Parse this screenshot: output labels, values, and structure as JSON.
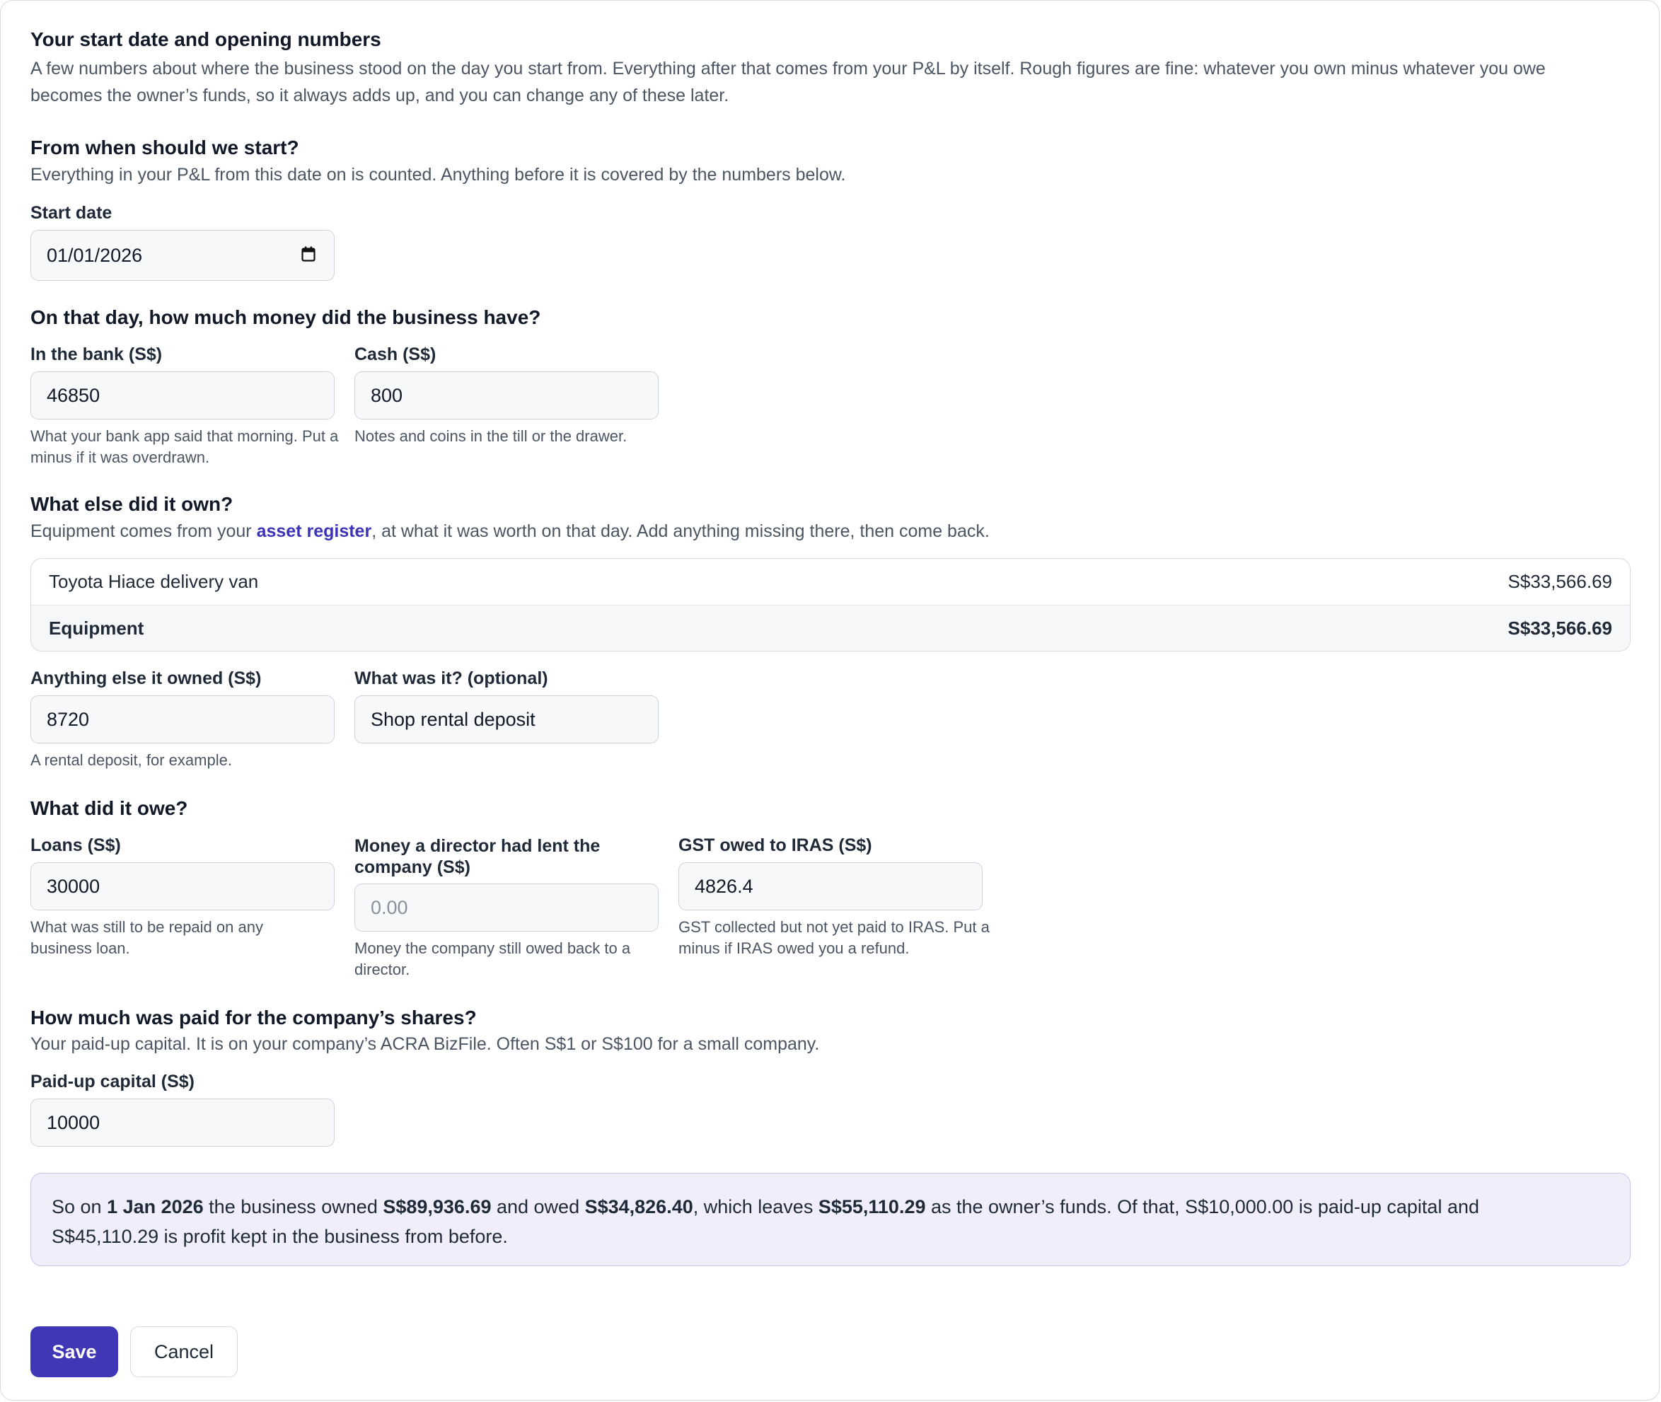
{
  "intro": {
    "title": "Your start date and opening numbers",
    "desc_line1": "A few numbers about where the business stood on the day you start from. Everything after that comes from your P&L by itself. Rough figures are fine: whatever you own minus whatever you owe",
    "desc_line2": "becomes the owner’s funds, so it always adds up, and you can change any of these later."
  },
  "start": {
    "heading": "From when should we start?",
    "desc": "Everything in your P&L from this date on is counted. Anything before it is covered by the numbers below.",
    "label": "Start date",
    "value": "01/01/2026",
    "icon": "calendar-icon"
  },
  "money": {
    "heading": "On that day, how much money did the business have?",
    "bank_label": "In the bank (S$)",
    "bank_value": "46850",
    "bank_hint": "What your bank app said that morning. Put a minus if it was overdrawn.",
    "cash_label": "Cash (S$)",
    "cash_value": "800",
    "cash_hint": "Notes and coins in the till or the drawer."
  },
  "owned": {
    "heading": "What else did it own?",
    "desc_before": "Equipment comes from your ",
    "desc_link": "asset register",
    "desc_after": ", at what it was worth on that day. Add anything missing there, then come back.",
    "equipment": [
      {
        "name": "Toyota Hiace delivery van",
        "value": "S$33,566.69"
      }
    ],
    "equipment_total_label": "Equipment",
    "equipment_total_value": "S$33,566.69",
    "other_label": "Anything else it owned (S$)",
    "other_value": "8720",
    "other_hint": "A rental deposit, for example.",
    "what_label": "What was it? (optional)",
    "what_value": "Shop rental deposit"
  },
  "owed": {
    "heading": "What did it owe?",
    "loans_label": "Loans (S$)",
    "loans_value": "30000",
    "loans_hint": "What was still to be repaid on any business loan.",
    "director_label": "Money a director had lent the company (S$)",
    "director_placeholder": "0.00",
    "director_hint": "Money the company still owed back to a director.",
    "gst_label": "GST owed to IRAS (S$)",
    "gst_value": "4826.4",
    "gst_hint": "GST collected but not yet paid to IRAS. Put a minus if IRAS owed you a refund."
  },
  "shares": {
    "heading": "How much was paid for the company’s shares?",
    "desc": "Your paid-up capital. It is on your company’s ACRA BizFile. Often S$1 or S$100 for a small company.",
    "label": "Paid-up capital (S$)",
    "value": "10000"
  },
  "summary": {
    "t1": "So on ",
    "date": "1 Jan 2026",
    "t2": " the business owned ",
    "owned": "S$89,936.69",
    "t3": " and owed ",
    "owed": "S$34,826.40",
    "t4": ", which leaves ",
    "funds": "S$55,110.29",
    "t5": " as the owner’s funds. Of that, S$10,000.00 is paid-up capital and",
    "t6": "S$45,110.29 is profit kept in the business from before."
  },
  "actions": {
    "save": "Save",
    "cancel": "Cancel"
  },
  "colors": {
    "primary": "#3f37b5",
    "summary_bg": "#efeefa",
    "link": "#3b34b8"
  }
}
